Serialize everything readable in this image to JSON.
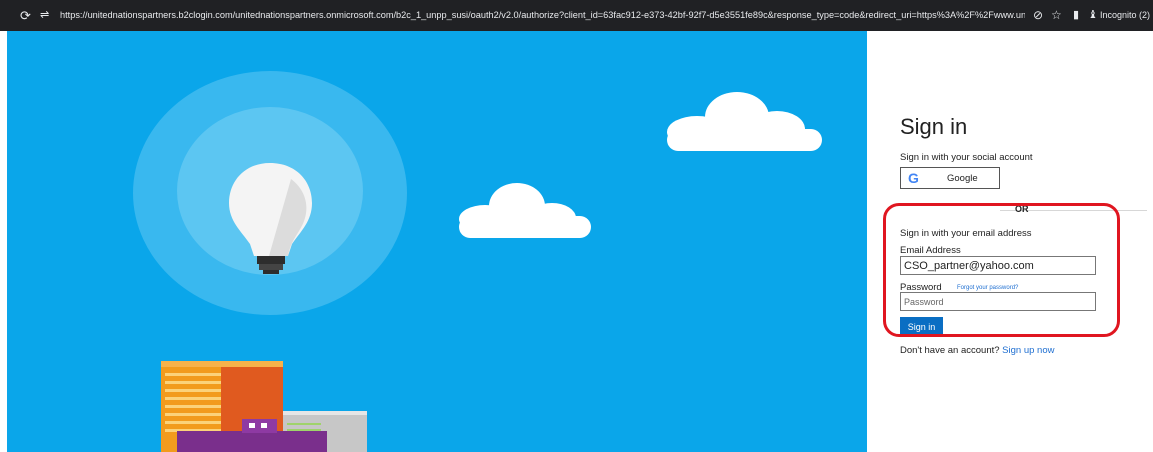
{
  "browser": {
    "url": "https://unitednationspartners.b2clogin.com/unitednationspartners.onmicrosoft.com/b2c_1_unpp_susi/oauth2/v2.0/authorize?client_id=63fac912-e373-42bf-92f7-d5e3551fe89c&response_type=code&redirect_uri=https%3A%2F%2Fwww.un...",
    "incognito_label": "Incognito (2)",
    "icons": [
      "reload-icon",
      "site-settings-icon",
      "eye-off-icon",
      "star-icon",
      "sidebar-icon",
      "incognito-icon"
    ]
  },
  "signin": {
    "title": "Sign in",
    "social_heading": "Sign in with your social account",
    "google_label": "Google",
    "or_label": "OR",
    "email_heading": "Sign in with your email address",
    "email_label": "Email Address",
    "email_value": "CSO_partner@yahoo.com",
    "password_label": "Password",
    "forgot_link": "Forgot your password?",
    "password_placeholder": "Password",
    "submit_label": "Sign in",
    "no_account_text": "Don't have an account?",
    "signup_link": "Sign up now"
  },
  "colors": {
    "sky": "#0aa6ea",
    "accent_button": "#0a6ec3",
    "link": "#1f6fd1",
    "highlight": "#e01620"
  }
}
